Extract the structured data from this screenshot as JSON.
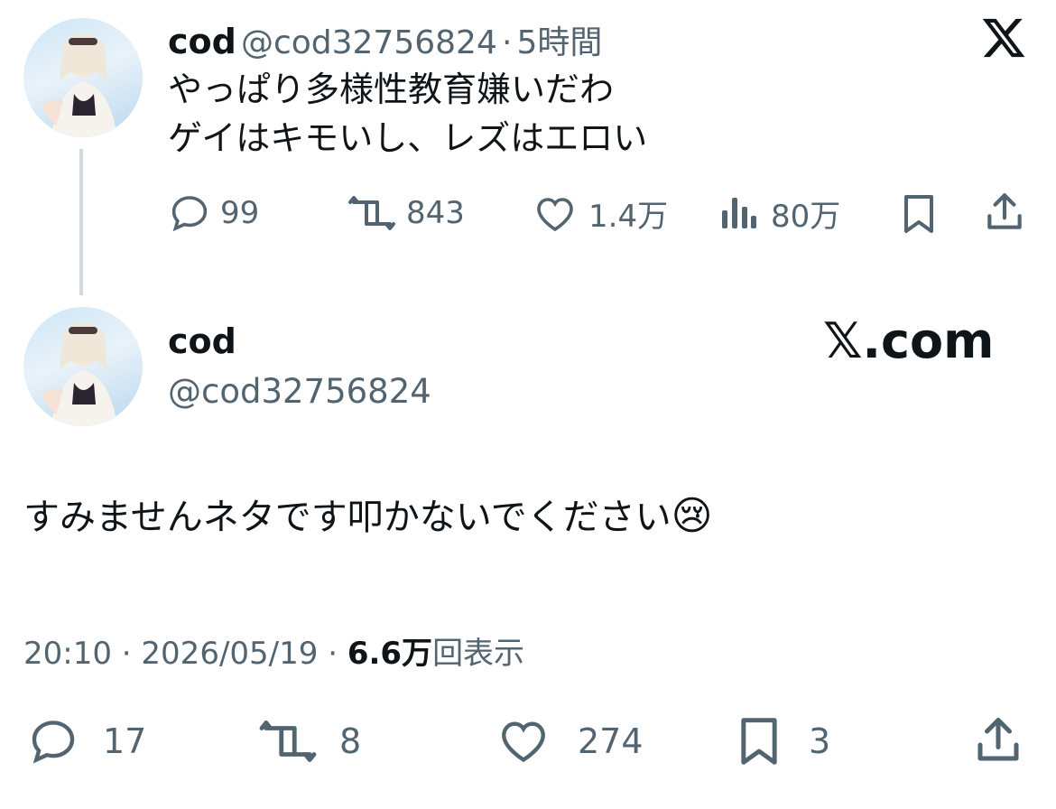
{
  "quoted_post": {
    "display_name": "cod",
    "handle": "@cod32756824",
    "separator": "·",
    "time_ago": "5時間",
    "lines": [
      "やっぱり多様性教育嫌いだわ",
      "ゲイはキモいし、レズはエロい"
    ],
    "actions": {
      "replies": "99",
      "reposts": "843",
      "likes": "1.4万",
      "views": "80万"
    }
  },
  "main_post": {
    "display_name": "cod",
    "handle": "@cod32756824",
    "site_label": "𝕏.com",
    "text": "すみませんネタです叩かないでください",
    "emoji": "😢",
    "time": "20:10",
    "date": "2026/05/19",
    "separator": "·",
    "view_count": "6.6万",
    "view_label": "回表示",
    "actions": {
      "replies": "17",
      "reposts": "8",
      "likes": "274",
      "bookmarks": "3"
    }
  },
  "icons": [
    "x-logo-icon",
    "reply-icon",
    "repost-icon",
    "like-icon",
    "views-icon",
    "bookmark-icon",
    "share-icon"
  ]
}
